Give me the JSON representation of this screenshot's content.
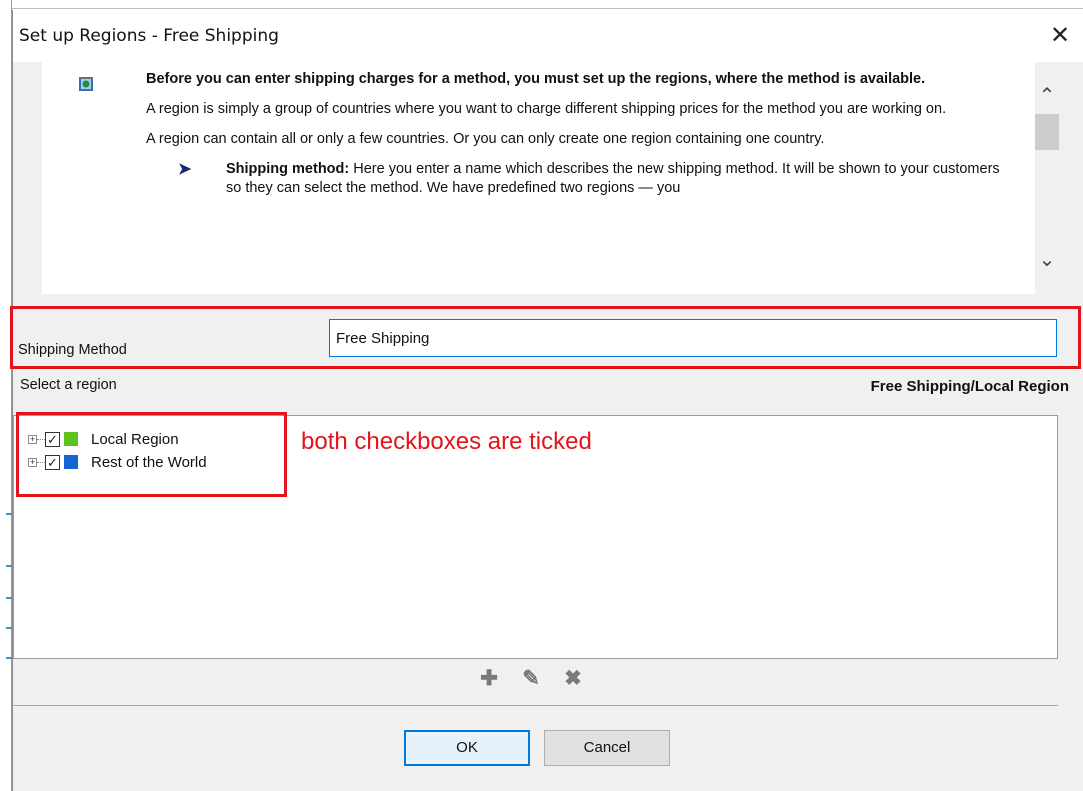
{
  "window": {
    "title": "Set up Regions - Free Shipping",
    "close_glyph": "✕"
  },
  "info": {
    "heading": "Before you can enter shipping charges for a method, you must set up the regions, where the method is available.",
    "paragraph1": "A region is simply a group of countries where you want to charge different shipping prices for the method you are working on.",
    "paragraph2": "A region can contain all or only a few countries. Or you can only create one region containing one country.",
    "bullet_term": "Shipping method:",
    "bullet_text": " Here you enter a name which describes the new shipping method. It will be shown to your customers so they can select the method. We have predefined two regions — you",
    "icon": "book-icon"
  },
  "shipping_method": {
    "label": "Shipping Method",
    "value": "Free Shipping"
  },
  "regions": {
    "label": "Select a region",
    "current": "Free Shipping/Local Region",
    "items": [
      {
        "label": "Local Region",
        "checked": true,
        "color": "#5cc21c"
      },
      {
        "label": "Rest of the World",
        "checked": true,
        "color": "#1464d2"
      }
    ]
  },
  "annotation": {
    "text": "both checkboxes are ticked",
    "color": "#e3141b"
  },
  "toolbar": {
    "add_icon": "plus-icon",
    "edit_icon": "pencil-icon",
    "delete_icon": "x-icon"
  },
  "buttons": {
    "ok": "OK",
    "cancel": "Cancel"
  }
}
